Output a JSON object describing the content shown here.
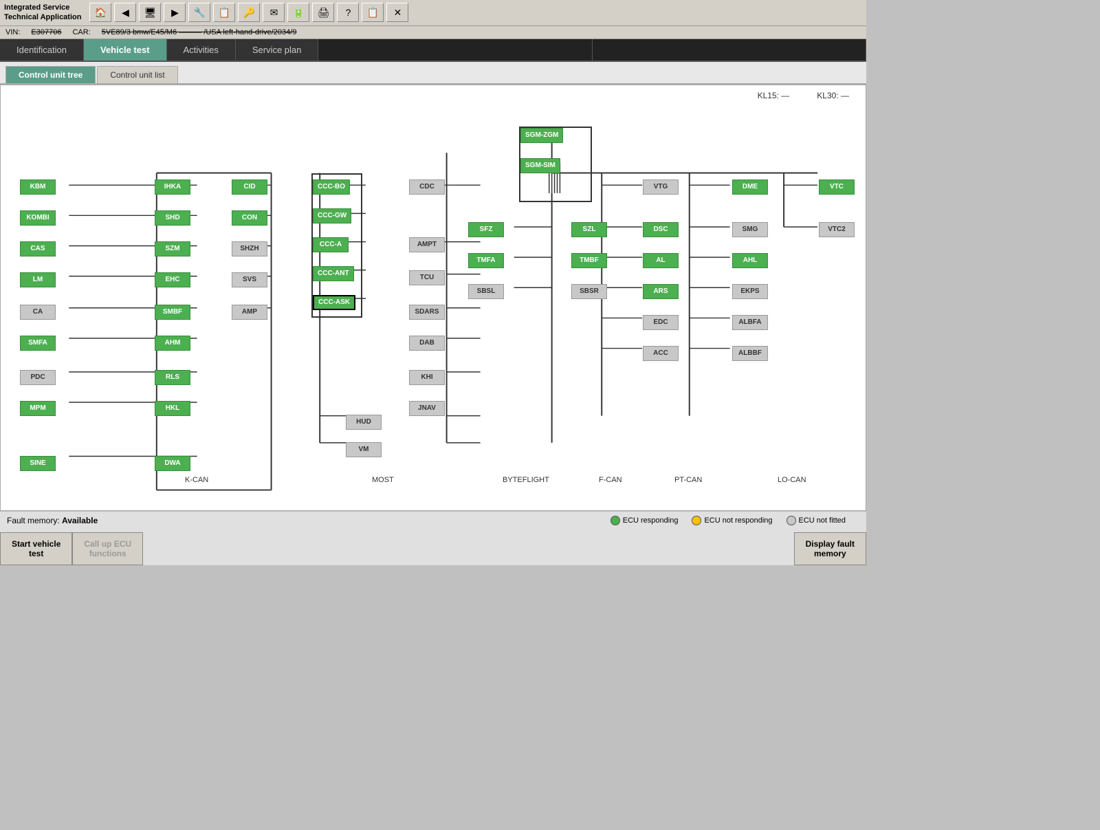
{
  "app": {
    "title_line1": "Integrated Service",
    "title_line2": "Technical Application"
  },
  "toolbar": {
    "buttons": [
      "🏠",
      "◀",
      "🖥",
      "▶",
      "🔧",
      "📋",
      "🔑",
      "✉",
      "🔋",
      "🖨",
      "?",
      "📋",
      "✕"
    ]
  },
  "vin_bar": {
    "vin_label": "VIN:",
    "vin_value": "E307706",
    "car_label": "CAR:",
    "car_value": "5VE89/3 bmw/E45/M6 ——— /USA left-hand-drive/2034/9"
  },
  "tabs": [
    {
      "label": "Identification",
      "active": false
    },
    {
      "label": "Vehicle test",
      "active": true
    },
    {
      "label": "Activities",
      "active": false
    },
    {
      "label": "Service plan",
      "active": false
    },
    {
      "label": "",
      "active": false
    },
    {
      "label": "",
      "active": false
    }
  ],
  "subtabs": [
    {
      "label": "Control unit tree",
      "active": true
    },
    {
      "label": "Control unit list",
      "active": false
    }
  ],
  "kl": {
    "kl15_label": "KL15:",
    "kl15_value": "—",
    "kl30_label": "KL30:",
    "kl30_value": "—"
  },
  "can_labels": [
    "K-CAN",
    "MOST",
    "BYTEFLIGHT",
    "F-CAN",
    "PT-CAN",
    "LO-CAN"
  ],
  "fault_memory": {
    "label": "Fault memory:",
    "value": "Available"
  },
  "legend": [
    {
      "label": "ECU responding",
      "color": "green"
    },
    {
      "label": "ECU not responding",
      "color": "yellow"
    },
    {
      "label": "ECU not fitted",
      "color": "gray"
    }
  ],
  "buttons": {
    "start_vehicle_test": "Start vehicle\ntest",
    "callup_ecu": "Call up ECU\nfunctions",
    "display_fault": "Display fault\nmemory"
  },
  "ecus": {
    "k_can_left": [
      "KBM",
      "KOMBI",
      "CAS",
      "LM",
      "CA",
      "SMFA",
      "PDC",
      "MPM",
      "SINE"
    ],
    "k_can_mid1": [
      "IHKA",
      "SHD",
      "SZM",
      "EHC",
      "SMBF",
      "AHM",
      "RLS",
      "HKL",
      "DWA"
    ],
    "k_can_mid2": [
      "CID",
      "CON",
      "SHZH",
      "SVS",
      "AMP"
    ],
    "most_group": [
      "CCC-BO",
      "CCC-GW",
      "CCC-A",
      "CCC-ANT",
      "CCC-ASK"
    ],
    "most_right": [
      "CDC",
      "AMPT",
      "TCU",
      "SDARS",
      "DAB",
      "KHI",
      "JNAV"
    ],
    "most_bottom": [
      "HUD",
      "VM"
    ],
    "byteflight": [
      "SGM-ZGM",
      "SGM-SIM",
      "SFZ",
      "TMFA",
      "SBSL",
      "TMBF",
      "SBSR",
      "SZL"
    ],
    "f_can": [
      "VTG",
      "DSC",
      "AL",
      "ARS",
      "EDC",
      "ACC"
    ],
    "pt_can": [
      "DME",
      "SMG",
      "AHL",
      "EKPS",
      "ALBFA",
      "ALBBF"
    ],
    "lo_can": [
      "VTC",
      "VTC2"
    ]
  }
}
